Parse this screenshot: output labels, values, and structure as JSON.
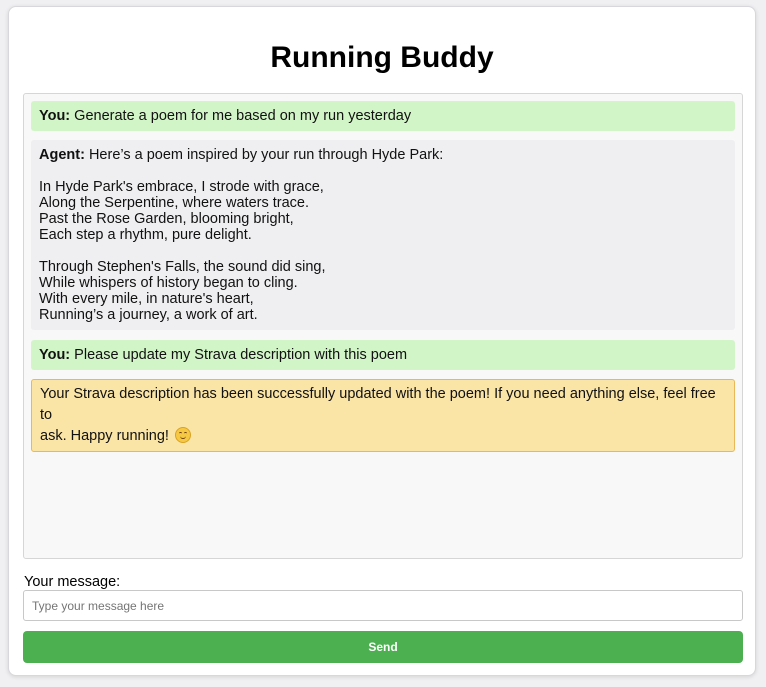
{
  "app": {
    "title": "Running Buddy"
  },
  "conversation": {
    "msg1": {
      "speaker": "You:",
      "text": "Generate a poem for me based on my run yesterday"
    },
    "msg2": {
      "speaker": "Agent:",
      "intro": "Here’s a poem inspired by your run through Hyde Park:",
      "stanza1": [
        "In Hyde Park's embrace, I strode with grace,",
        "Along the Serpentine, where waters trace.",
        "Past the Rose Garden, blooming bright,",
        "Each step a rhythm, pure delight."
      ],
      "stanza2": [
        "Through Stephen's Falls, the sound did sing,",
        "While whispers of history began to cling.",
        "With every mile, in nature's heart,",
        "Running’s a journey, a work of art."
      ]
    },
    "msg3": {
      "speaker": "You:",
      "text": "Please update my Strava description with this poem"
    },
    "msg4": {
      "line1": "Your Strava description has been successfully updated with the poem! If you need anything else, feel free to",
      "line2": "ask. Happy running!",
      "emoji": "smiling-face-icon"
    }
  },
  "composer": {
    "label": "Your message:",
    "placeholder": "Type your message here",
    "value": "",
    "send_label": "Send"
  },
  "colors": {
    "user_bubble": "#d2f5c8",
    "agent_bubble": "#efeff2",
    "success_bubble": "#fae4a6",
    "send_button": "#4caf50"
  }
}
